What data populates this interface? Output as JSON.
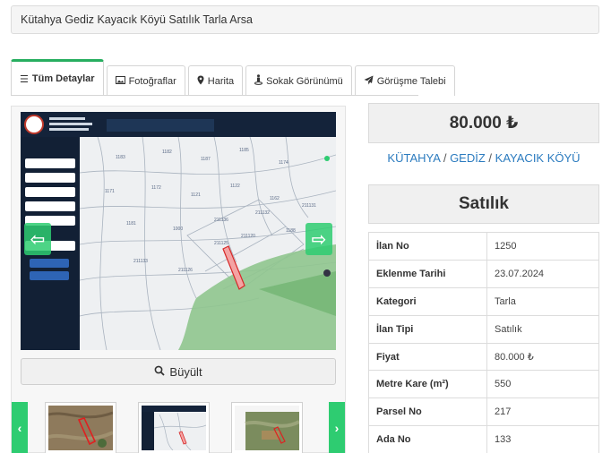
{
  "header": {
    "title": "Kütahya Gediz Kayacık Köyü Satılık Tarla Arsa"
  },
  "tabs": [
    {
      "label": "Tüm Detaylar",
      "icon": "list-icon",
      "active": true
    },
    {
      "label": "Fotoğraflar",
      "icon": "image-icon"
    },
    {
      "label": "Harita",
      "icon": "map-marker-icon"
    },
    {
      "label": "Sokak Görünümü",
      "icon": "street-view-icon"
    },
    {
      "label": "Görüşme Talebi",
      "icon": "paper-plane-icon"
    }
  ],
  "gallery": {
    "zoom_label": "Büyült",
    "prev_arrow": "⇦",
    "next_arrow": "⇨",
    "thumb_prev": "‹",
    "thumb_next": "›",
    "map_parcels": [
      "1183",
      "1182",
      "1187",
      "1185",
      "1174",
      "1171",
      "1172",
      "1121",
      "1122",
      "1162",
      "1181",
      "1000",
      "211136",
      "211132",
      "211131",
      "211133",
      "211126",
      "211125",
      "211120",
      "1188"
    ],
    "accent_color": "#2ecc71"
  },
  "listing": {
    "price": "80.000 ₺",
    "location": {
      "city": "KÜTAHYA",
      "district": "GEDİZ",
      "village": "KAYACIK KÖYÜ",
      "separator": "/"
    },
    "status": "Satılık",
    "details": [
      {
        "key": "İlan No",
        "value": "1250"
      },
      {
        "key": "Eklenme Tarihi",
        "value": "23.07.2024"
      },
      {
        "key": "Kategori",
        "value": "Tarla"
      },
      {
        "key": "İlan Tipi",
        "value": "Satılık"
      },
      {
        "key": "Fiyat",
        "value": "80.000 ₺"
      },
      {
        "key": "Metre Kare (m²)",
        "value": "550"
      },
      {
        "key": "Parsel No",
        "value": "217"
      },
      {
        "key": "Ada No",
        "value": "133"
      }
    ]
  }
}
